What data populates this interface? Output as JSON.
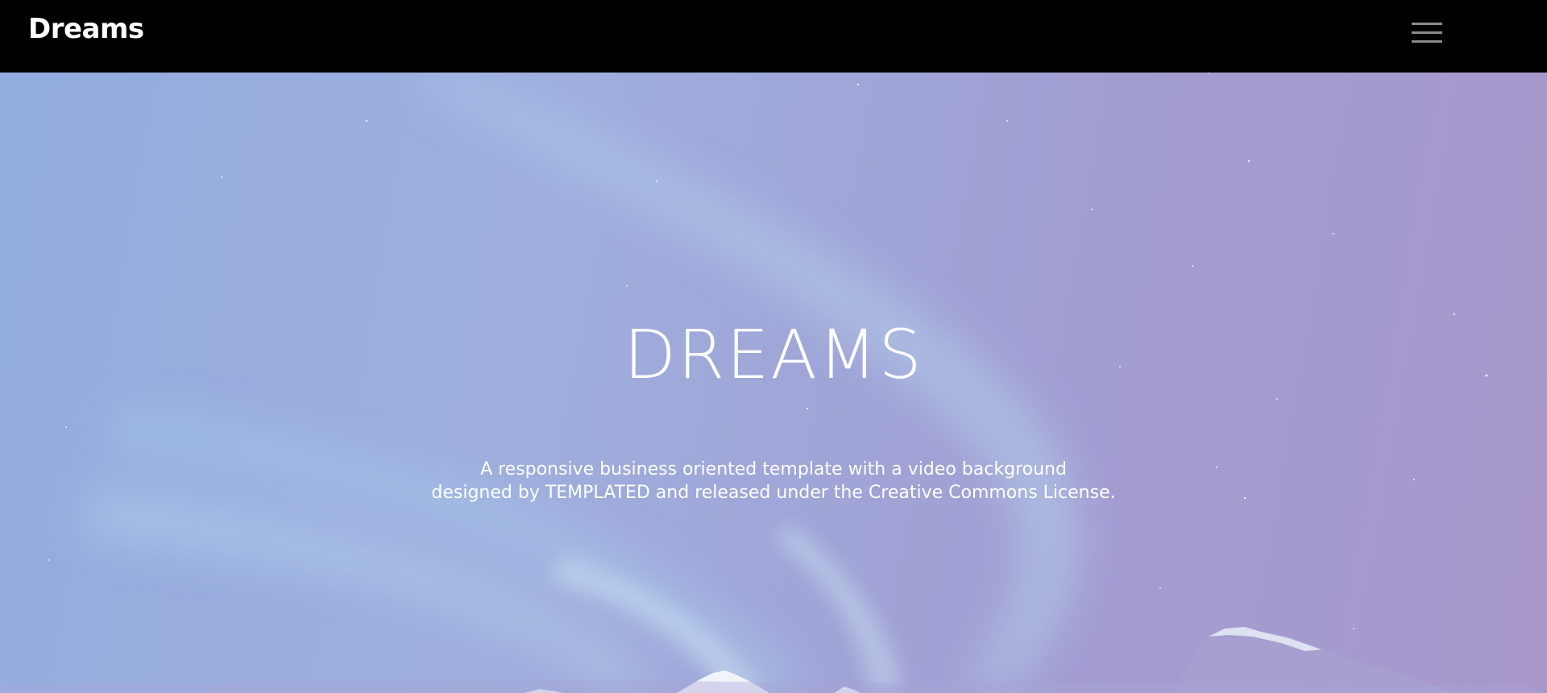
{
  "header": {
    "logo": "Dreams",
    "menu_icon": "hamburger-menu-icon"
  },
  "hero": {
    "title": "DREAMS",
    "subtitle_line1": "A responsive business oriented template with a video background",
    "subtitle_line2": "designed by TEMPLATED and released under the Creative Commons License."
  },
  "colors": {
    "header_bg": "#000000",
    "hero_tint": "#a29dd1",
    "text": "#ffffff",
    "menu_lines": "#8a8a8a"
  }
}
